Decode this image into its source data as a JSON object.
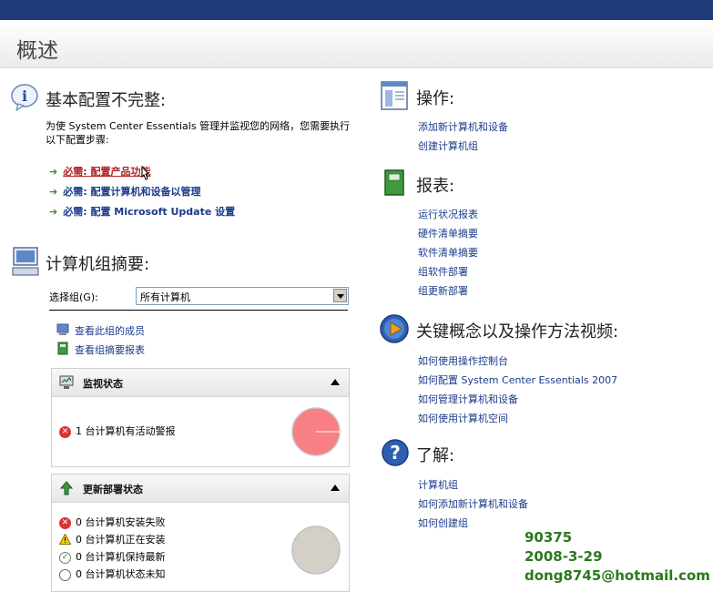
{
  "page_title": "概述",
  "config": {
    "title": "基本配置不完整:",
    "description_line1": "为使 System Center Essentials 管理并监视您的网络，您需要执行",
    "description_line2": "以下配置步骤:",
    "steps": [
      "必需: 配置产品功能",
      "必需: 配置计算机和设备以管理",
      "必需: 配置 Microsoft Update 设置"
    ]
  },
  "group_summary": {
    "title": "计算机组摘要:",
    "select_label": "选择组(G):",
    "select_value": "所有计算机",
    "links": [
      "查看此组的成员",
      "查看组摘要报表"
    ]
  },
  "monitor_panel": {
    "title": "监视状态",
    "rows": [
      "1 台计算机有活动警报"
    ],
    "pie_color": "#f87f85"
  },
  "update_panel": {
    "title": "更新部署状态",
    "rows": [
      "0 台计算机安装失败",
      "0 台计算机正在安装",
      "0 台计算机保持最新",
      "0 台计算机状态未知"
    ],
    "pie_color": "#d4d0c8"
  },
  "actions": {
    "title": "操作:",
    "links": [
      "添加新计算机和设备",
      "创建计算机组"
    ]
  },
  "reports": {
    "title": "报表:",
    "links": [
      "运行状况报表",
      "硬件清单摘要",
      "软件清单摘要",
      "组软件部署",
      "组更新部署"
    ]
  },
  "videos": {
    "title": "关键概念以及操作方法视频:",
    "links": [
      "如何使用操作控制台",
      "如何配置 System Center Essentials 2007",
      "如何管理计算机和设备",
      "如何使用计算机空间"
    ]
  },
  "learn": {
    "title": "了解:",
    "links": [
      "计算机组",
      "如何添加新计算机和设备",
      "如何创建组"
    ]
  },
  "overlay": {
    "line1": "90375",
    "line2": "2008-3-29",
    "line3": "dong8745@hotmail.com"
  },
  "colors": {
    "topbar": "#1f3b7a",
    "link": "#1a3a8a",
    "overlay_text": "#2a7a1a"
  }
}
